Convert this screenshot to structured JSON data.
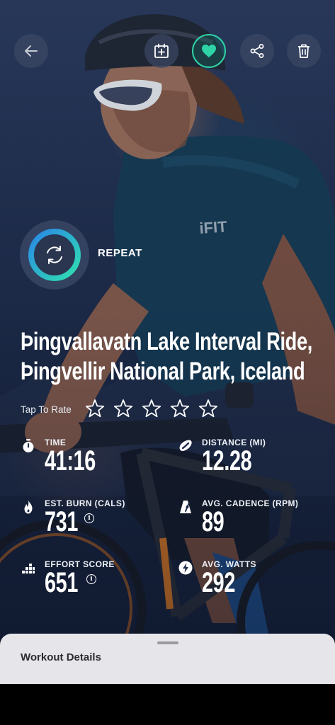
{
  "header": {
    "back_icon": "arrow-left-icon",
    "schedule_icon": "calendar-add-icon",
    "favorite_icon": "heart-icon",
    "share_icon": "share-icon",
    "delete_icon": "trash-icon",
    "favorite_active": true,
    "accent_color": "#2ed3a6"
  },
  "repeat": {
    "label": "REPEAT",
    "icon": "repeat-icon"
  },
  "workout": {
    "title_line1": "Þingvallavatn Lake Interval Ride,",
    "title_line2": "Þingvellir National Park, Iceland"
  },
  "rating": {
    "label": "Tap To Rate",
    "max_stars": 5,
    "value": 0
  },
  "stats": {
    "time": {
      "label": "TIME",
      "value": "41:16",
      "icon": "stopwatch-icon"
    },
    "distance": {
      "label": "DISTANCE (MI)",
      "value": "12.28",
      "icon": "distance-icon"
    },
    "burn": {
      "label": "EST. BURN (CALS)",
      "value": "731",
      "icon": "flame-icon",
      "info": "i"
    },
    "cadence": {
      "label": "AVG. CADENCE (RPM)",
      "value": "89",
      "icon": "metronome-icon"
    },
    "effort": {
      "label": "EFFORT SCORE",
      "value": "651",
      "icon": "effort-bars-icon",
      "info": "i"
    },
    "watts": {
      "label": "AVG. WATTS",
      "value": "292",
      "icon": "lightning-icon"
    }
  },
  "sheet": {
    "title": "Workout Details"
  }
}
